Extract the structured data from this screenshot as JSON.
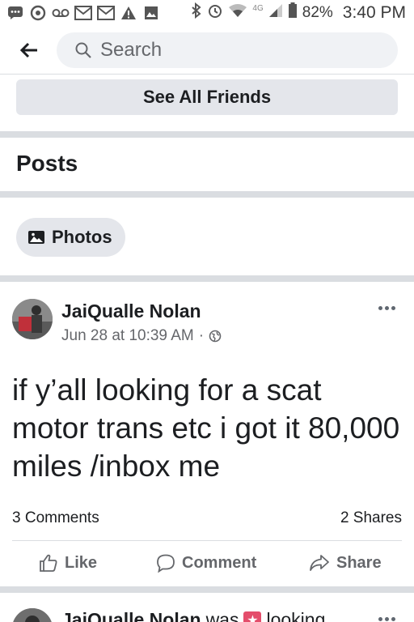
{
  "status_bar": {
    "battery": "82%",
    "time": "3:40 PM",
    "network": "4G",
    "icons": [
      "chat-icon",
      "messenger-icon",
      "voicemail-icon",
      "gmail-icon",
      "gmail-icon",
      "warning-icon",
      "image-icon",
      "bluetooth-icon",
      "alarm-icon",
      "wifi-icon",
      "signal-icon",
      "battery-icon"
    ]
  },
  "search": {
    "placeholder": "Search"
  },
  "friends": {
    "see_all_label": "See All Friends"
  },
  "posts_section": {
    "heading": "Posts",
    "photos_chip": "Photos"
  },
  "post": {
    "author": "JaiQualle Nolan",
    "timestamp": "Jun 28 at 10:39 AM",
    "separator": "·",
    "text": "if y’all looking for a scat motor trans etc i got it 80,000 miles /inbox me",
    "comments": "3 Comments",
    "shares": "2 Shares",
    "actions": {
      "like": "Like",
      "comment": "Comment",
      "share": "Share"
    }
  },
  "next_post": {
    "author": "JaiQualle Nolan",
    "status_text": "was",
    "activity": "looking"
  },
  "colors": {
    "divider": "#dadde1",
    "chip_bg": "#e4e6eb",
    "secondary_text": "#65676b",
    "badge": "#e44d6b"
  }
}
